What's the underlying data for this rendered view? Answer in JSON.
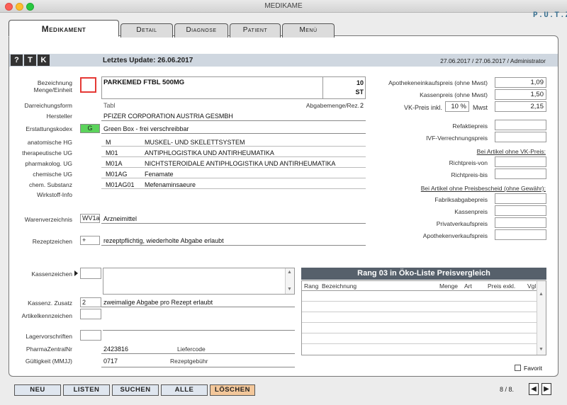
{
  "window": {
    "title": "MEDIKAME"
  },
  "logo": "P.U.T.Z",
  "tabs": [
    {
      "label": "Medikament",
      "active": true
    },
    {
      "label": "Detail"
    },
    {
      "label": "Diagnose"
    },
    {
      "label": "Patient"
    },
    {
      "label": "Menü"
    }
  ],
  "header": {
    "buttons": [
      "?",
      "T",
      "K"
    ],
    "last_update": "Letztes Update: 26.06.2017",
    "date_info": "27.06.2017 / 27.06.2017 / Administrator"
  },
  "left": {
    "bezeichnung_label": "Bezeichnung",
    "menge_label": "Menge/Einheit",
    "bezeichnung": "PARKEMED FTBL 500MG",
    "menge": "10",
    "einheit": "ST",
    "darreichung_label": "Darreichungsform",
    "darreichung": "Tabl",
    "abgabemenge_label": "Abgabemenge/Rez.",
    "abgabemenge": "2",
    "hersteller_label": "Hersteller",
    "hersteller": "PFIZER CORPORATION AUSTRIA GESMBH",
    "erstattung_label": "Erstattungskodex",
    "erstattung_code": "G",
    "erstattung_text": "Green Box - frei verschreibbar",
    "classifications": [
      {
        "label": "anatomische HG",
        "code": "M",
        "text": "MUSKEL- UND SKELETTSYSTEM"
      },
      {
        "label": "therapeutische UG",
        "code": "M01",
        "text": "ANTIPHLOGISTIKA UND ANTIRHEUMATIKA"
      },
      {
        "label": "pharmakolog. UG",
        "code": "M01A",
        "text": "NICHTSTEROIDALE ANTIPHLOGISTIKA UND ANTIRHEUMATIKA"
      },
      {
        "label": "chemische UG",
        "code": "M01AG",
        "text": "Fenamate"
      },
      {
        "label": "chem. Substanz",
        "code": "M01AG01",
        "text": "Mefenaminsaeure"
      }
    ],
    "wirkstoff_label": "Wirkstoff-Info",
    "waren_label": "Warenverzeichnis",
    "waren_code": "WV1a",
    "waren_text": "Arzneimittel",
    "rezept_label": "Rezeptzeichen",
    "rezept_code": "+",
    "rezept_text": "rezeptpflichtig, wiederholte Abgabe erlaubt",
    "kassen_label": "Kassenzeichen",
    "kassen_zusatz_label": "Kassenz. Zusatz",
    "kassen_zusatz_code": "2",
    "kassen_zusatz_text": "zweimalige Abgabe pro Rezept erlaubt",
    "artikel_label": "Artikelkennzeichen",
    "lager_label": "Lagervorschriften",
    "pzn_label": "PharmaZentralNr",
    "pzn": "2423816",
    "liefercode_label": "Liefercode",
    "gueltig_label": "Gültigkeit (MMJJ)",
    "gueltig": "0717",
    "rezeptgebuehr_label": "Rezeptgebühr"
  },
  "right": {
    "aek_label": "Apothekeneinkaufspreis (ohne Mwst)",
    "aek": "1,09",
    "kp_label": "Kassenpreis (ohne Mwst)",
    "kp": "1,50",
    "vk_label": "VK-Preis inkl.",
    "vk_mwst": "10 %",
    "mwst_label": "Mwst",
    "vk": "2,15",
    "refakt_label": "Refaktiepreis",
    "ivf_label": "IVF-Verrechnungspreis",
    "vk_section": "Bei Artikel ohne VK-Preis:",
    "richt_von_label": "Richtpreis-von",
    "richt_bis_label": "Richtpreis-bis",
    "preisbescheid_section": "Bei Artikel ohne Preisbescheid (ohne Gewähr):",
    "fabrik_label": "Fabriksabgabepreis",
    "kassenpreis2_label": "Kassenpreis",
    "privat_label": "Privatverkaufspreis",
    "apotheke_label": "Apothekenverkaufspreis"
  },
  "oeko": {
    "title": "Rang 03 in Öko-Liste Preisvergleich",
    "columns": [
      "Rang",
      "Bezeichnung",
      "Menge",
      "Art",
      "Preis exkl.",
      "Vgl"
    ],
    "favorit_label": "Favorit"
  },
  "buttons": {
    "neu": "NEU",
    "listen": "LISTEN",
    "suchen": "SUCHEN",
    "alle": "ALLE",
    "loeschen": "LÖSCHEN"
  },
  "pager": "8 / 8.",
  "colors": {
    "header_bar": "#cfd7e0",
    "oeko_title": "#56606b",
    "green": "#5bd35b",
    "loeschen": "#f3c79a"
  }
}
